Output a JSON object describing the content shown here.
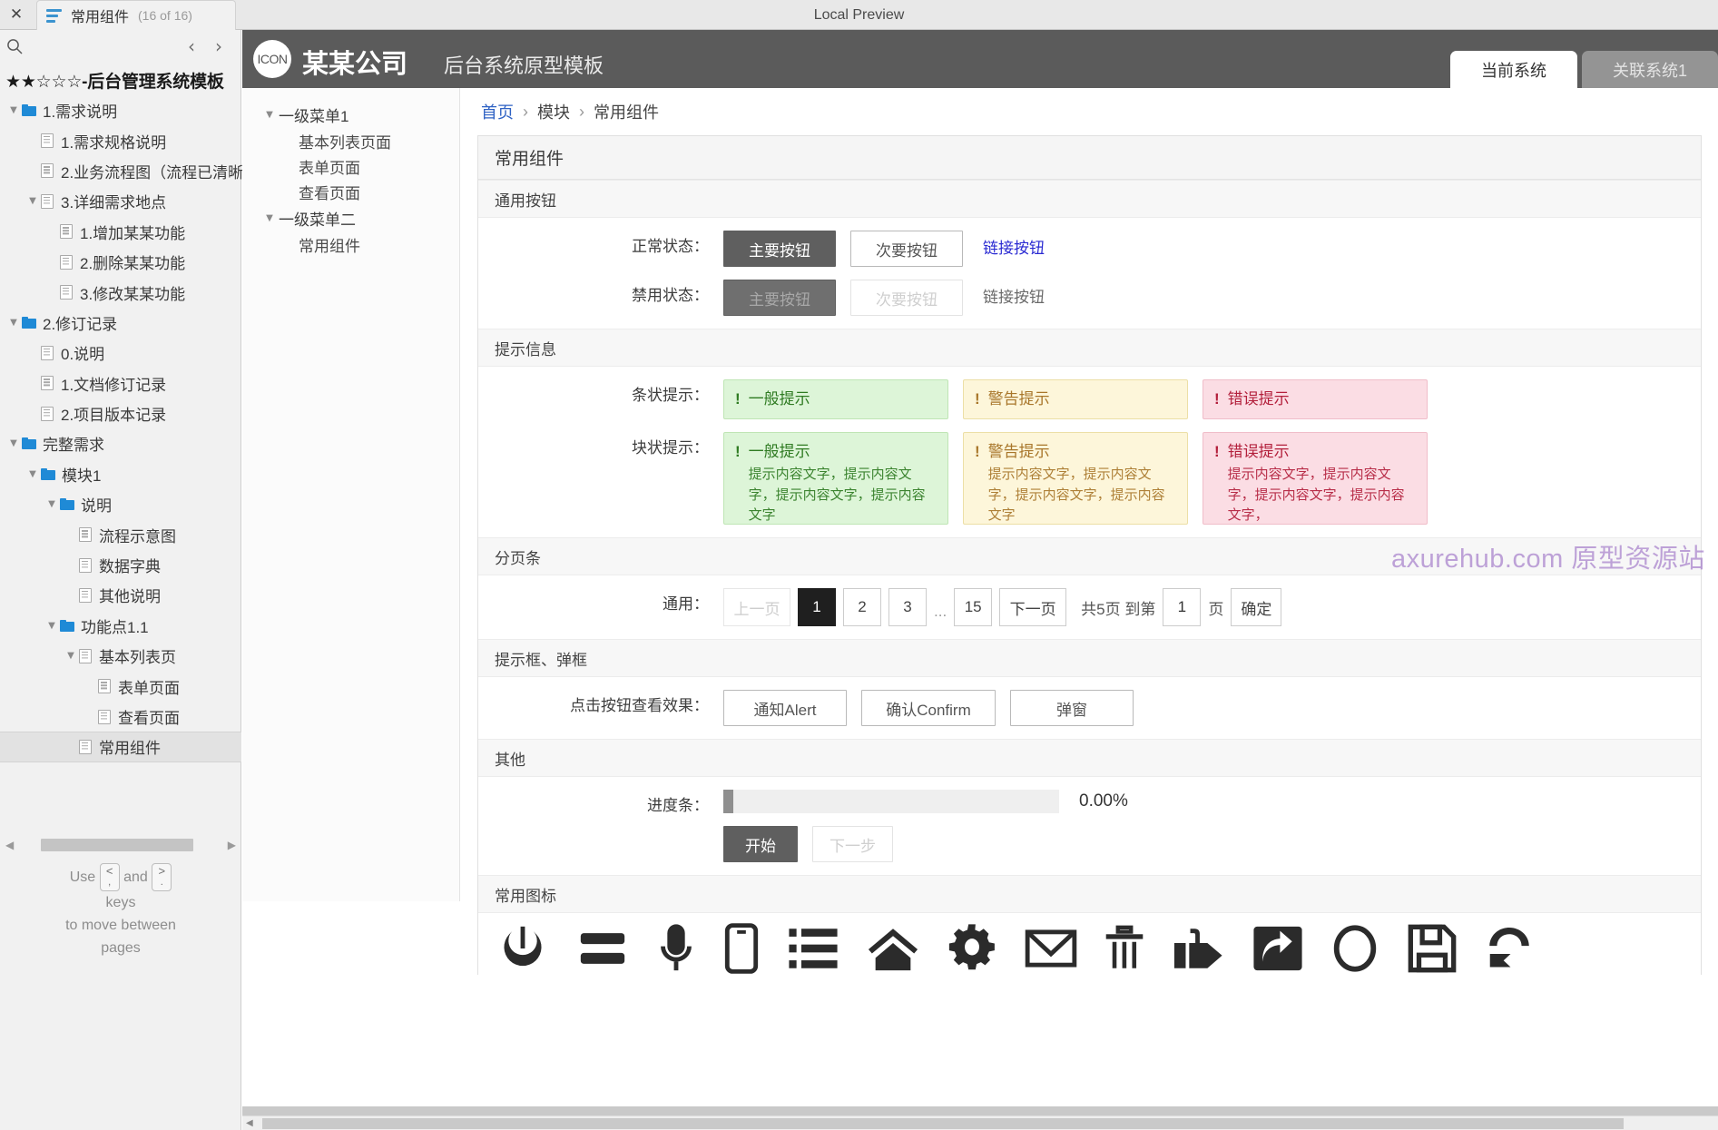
{
  "topbar": {
    "close_label": "✕",
    "tab_title": "常用组件",
    "tab_count": "(16 of 16)",
    "center_title": "Local Preview"
  },
  "sitemap": {
    "title": "★★☆☆☆-后台管理系统模板",
    "prev_label": "‹",
    "next_label": "›",
    "items": [
      {
        "label": "1.需求说明",
        "indent": 0,
        "caret": "▼",
        "icon": "folder",
        "selected": false
      },
      {
        "label": "1.需求规格说明",
        "indent": 1,
        "caret": "",
        "icon": "page",
        "selected": false
      },
      {
        "label": "2.业务流程图（流程已清晰",
        "indent": 1,
        "caret": "",
        "icon": "page",
        "selected": false
      },
      {
        "label": "3.详细需求地点",
        "indent": 1,
        "caret": "▼",
        "icon": "page",
        "selected": false
      },
      {
        "label": "1.增加某某功能",
        "indent": 2,
        "caret": "",
        "icon": "page",
        "selected": false
      },
      {
        "label": "2.删除某某功能",
        "indent": 2,
        "caret": "",
        "icon": "page",
        "selected": false
      },
      {
        "label": "3.修改某某功能",
        "indent": 2,
        "caret": "",
        "icon": "page",
        "selected": false
      },
      {
        "label": "2.修订记录",
        "indent": 0,
        "caret": "▼",
        "icon": "folder",
        "selected": false
      },
      {
        "label": "0.说明",
        "indent": 1,
        "caret": "",
        "icon": "page",
        "selected": false
      },
      {
        "label": "1.文档修订记录",
        "indent": 1,
        "caret": "",
        "icon": "page",
        "selected": false
      },
      {
        "label": "2.项目版本记录",
        "indent": 1,
        "caret": "",
        "icon": "page",
        "selected": false
      },
      {
        "label": "完整需求",
        "indent": 0,
        "caret": "▼",
        "icon": "folder",
        "selected": false
      },
      {
        "label": "模块1",
        "indent": 1,
        "caret": "▼",
        "icon": "folder",
        "selected": false
      },
      {
        "label": "说明",
        "indent": 2,
        "caret": "▼",
        "icon": "folder",
        "selected": false
      },
      {
        "label": "流程示意图",
        "indent": 3,
        "caret": "",
        "icon": "page",
        "selected": false
      },
      {
        "label": "数据字典",
        "indent": 3,
        "caret": "",
        "icon": "page",
        "selected": false
      },
      {
        "label": "其他说明",
        "indent": 3,
        "caret": "",
        "icon": "page",
        "selected": false
      },
      {
        "label": "功能点1.1",
        "indent": 2,
        "caret": "▼",
        "icon": "folder",
        "selected": false
      },
      {
        "label": "基本列表页",
        "indent": 3,
        "caret": "▼",
        "icon": "page",
        "selected": false
      },
      {
        "label": "表单页面",
        "indent": 4,
        "caret": "",
        "icon": "page",
        "selected": false
      },
      {
        "label": "查看页面",
        "indent": 4,
        "caret": "",
        "icon": "page",
        "selected": false
      },
      {
        "label": "常用组件",
        "indent": 3,
        "caret": "",
        "icon": "page",
        "selected": true
      }
    ],
    "hint": {
      "use": "Use",
      "and": "and",
      "key_prev_top": "<",
      "key_prev_bottom": ",",
      "key_next_top": ">",
      "key_next_bottom": ".",
      "line2": "keys",
      "line3": "to move between",
      "line4": "pages"
    }
  },
  "app": {
    "logo_text": "ICON",
    "brand_name": "某某公司",
    "brand_sub": "后台系统原型模板",
    "system_tabs": [
      {
        "label": "当前系统",
        "active": true
      },
      {
        "label": "关联系统1",
        "active": false
      }
    ],
    "menu": [
      {
        "label": "一级菜单1",
        "caret": "▼",
        "children": [
          "基本列表页面",
          "表单页面",
          "查看页面"
        ]
      },
      {
        "label": "一级菜单二",
        "caret": "▼",
        "children": [
          "常用组件"
        ]
      }
    ],
    "breadcrumb": {
      "home": "首页",
      "sep": "›",
      "module": "模块",
      "current": "常用组件"
    },
    "page_title": "常用组件",
    "watermark": "axurehub.com 原型资源站",
    "sections": {
      "buttons": {
        "heading": "通用按钮",
        "normal_label": "正常状态：",
        "disabled_label": "禁用状态：",
        "primary": "主要按钮",
        "secondary": "次要按钮",
        "link": "链接按钮"
      },
      "alerts": {
        "heading": "提示信息",
        "bar_label": "条状提示：",
        "block_label": "块状提示：",
        "bang": "!",
        "info_title": "一般提示",
        "warn_title": "警告提示",
        "error_title": "错误提示",
        "info_desc": "提示内容文字，提示内容文字，提示内容文字，提示内容文字",
        "warn_desc": "提示内容文字，提示内容文字，提示内容文字，提示内容文字",
        "error_desc": "提示内容文字，提示内容文字，提示内容文字，提示内容文字，"
      },
      "pagination": {
        "heading": "分页条",
        "label": "通用：",
        "prev": "上一页",
        "pages": [
          "1",
          "2",
          "3"
        ],
        "ellipsis": "...",
        "last_page": "15",
        "next": "下一页",
        "total_text": "共5页 到第",
        "jump_value": "1",
        "page_unit": "页",
        "confirm": "确定"
      },
      "dialogs": {
        "heading": "提示框、弹框",
        "label": "点击按钮查看效果：",
        "alert_btn": "通知Alert",
        "confirm_btn": "确认Confirm",
        "modal_btn": "弹窗"
      },
      "other": {
        "heading": "其他",
        "progress_label": "进度条：",
        "progress_value": "0.00%",
        "progress_percent": 3,
        "start_btn": "开始",
        "next_btn": "下一步"
      },
      "icons": {
        "heading": "常用图标",
        "names": [
          "power-icon",
          "menu-icon",
          "microphone-icon",
          "mobile-icon",
          "list-icon",
          "home-icon",
          "gear-icon",
          "mail-icon",
          "trash-icon",
          "thumbs-up-icon",
          "share-icon",
          "search-icon",
          "save-icon",
          "undo-icon"
        ]
      }
    }
  }
}
